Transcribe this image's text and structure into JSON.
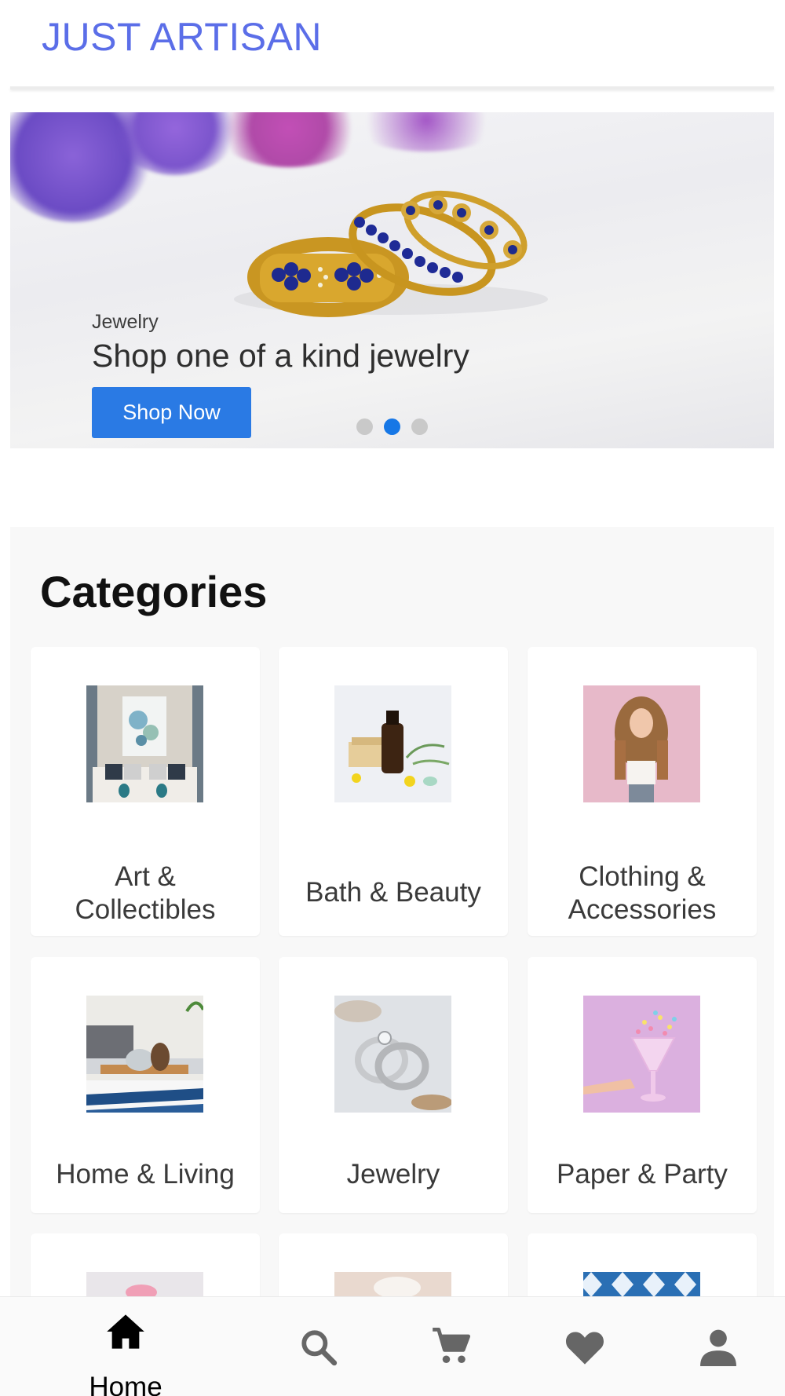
{
  "header": {
    "title": "JUST ARTISAN"
  },
  "banner": {
    "kicker": "Jewelry",
    "headline": "Shop one of a kind jewelry",
    "cta_label": "Shop Now",
    "slides_total": 3,
    "active_slide": 2
  },
  "categories": {
    "heading": "Categories",
    "items": [
      {
        "label_line1": "Art &",
        "label_line2": "Collectibles"
      },
      {
        "label_line1": "Bath & Beauty"
      },
      {
        "label_line1": "Clothing &",
        "label_line2": "Accessories"
      },
      {
        "label_line1": "Home & Living"
      },
      {
        "label_line1": "Jewelry"
      },
      {
        "label_line1": "Paper & Party"
      }
    ]
  },
  "bottom_nav": {
    "home_label": "Home",
    "items": [
      "home-icon",
      "search-icon",
      "cart-icon",
      "heart-icon",
      "profile-icon"
    ]
  },
  "colors": {
    "brand": "#5b6ee8",
    "cta": "#2a7ae4",
    "active_dot": "#1677e6"
  }
}
